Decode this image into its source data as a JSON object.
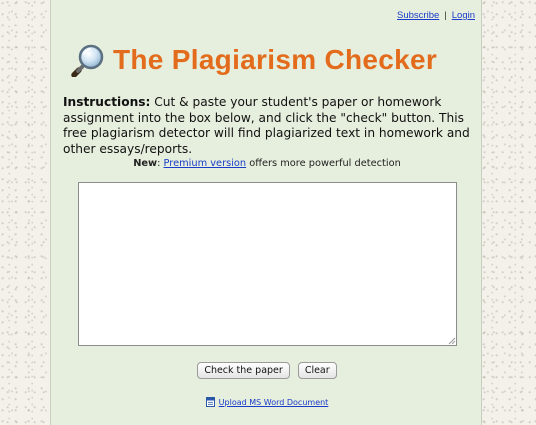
{
  "header": {
    "subscribe_label": "Subscribe",
    "separator": "|",
    "login_label": "Login"
  },
  "branding": {
    "title": "The Plagiarism Checker",
    "title_color": "#e36c1c",
    "icon": "magnifying-glass-icon"
  },
  "instructions": {
    "label": "Instructions:",
    "text": " Cut & paste your student's paper or homework assignment into the box below, and click the \"check\" button. This free plagiarism detector will find plagiarized text in homework and other essays/reports."
  },
  "promo": {
    "new_label": "New",
    "colon": ": ",
    "link_text": "Premium version",
    "rest_text": " offers more powerful detection"
  },
  "paper_input": {
    "value": "",
    "placeholder": ""
  },
  "actions": {
    "check_label": "Check the paper",
    "clear_label": "Clear"
  },
  "upload": {
    "label": "Upload MS Word Document",
    "icon": "word-document-icon"
  },
  "colors": {
    "panel_background": "#e6eedd",
    "link": "#1a3cc8"
  }
}
